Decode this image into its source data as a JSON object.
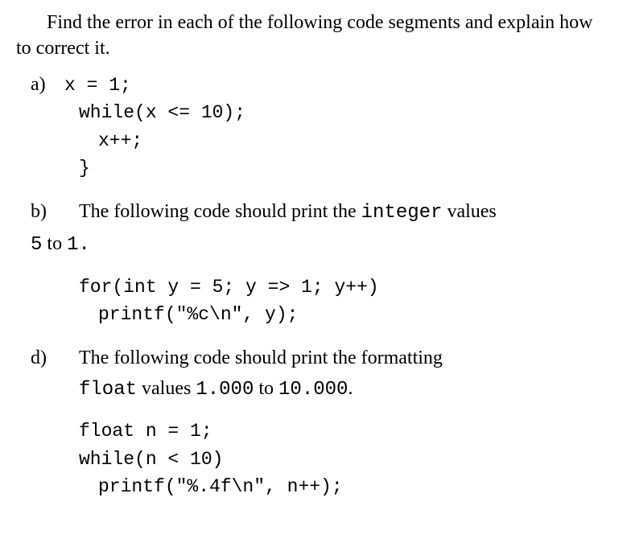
{
  "intro": "Find the error in each of the following code segments and explain how to correct it.",
  "partA": {
    "label": "a)",
    "line1": "x = 1;",
    "line2": "while(x <= 10);",
    "line3": "x++;",
    "line4": "}"
  },
  "partB": {
    "label": "b)",
    "desc_pre": "The following code should print the ",
    "desc_code": "integer",
    "desc_post": " values",
    "sub_pre": "5",
    "sub_mid": " to ",
    "sub_post": "1.",
    "line1": "for(int y = 5; y => 1; y++)",
    "line2": "printf(\"%c\\n\", y);"
  },
  "partD": {
    "label": "d)",
    "desc": "The following code should print the formatting",
    "sub_code1": "float",
    "sub_mid1": " values ",
    "sub_code2": "1.000",
    "sub_mid2": " to ",
    "sub_code3": "10.000",
    "sub_end": ".",
    "line1": "float n = 1;",
    "line2": "while(n < 10)",
    "line3": "printf(\"%.4f\\n\", n++);"
  }
}
